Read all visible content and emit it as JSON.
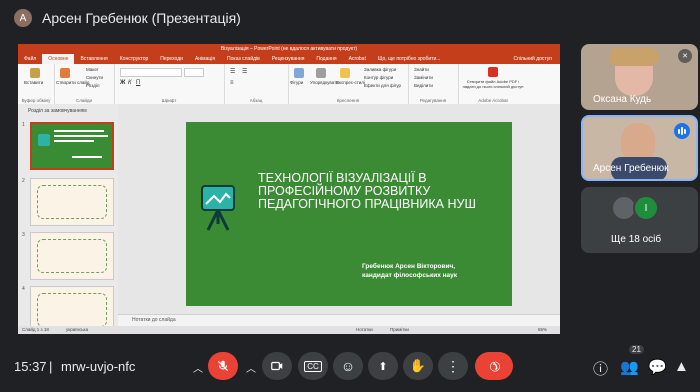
{
  "header": {
    "presenter_initial": "А",
    "title": "Арсен Гребенюк (Презентація)"
  },
  "powerpoint": {
    "window_title": "Візуалізація – PowerPoint (не вдалося активувати продукт)",
    "tabs": [
      "Файл",
      "Основне",
      "Вставлення",
      "Конструктор",
      "Переходи",
      "Анімація",
      "Показ слайдів",
      "Рецензування",
      "Подання",
      "Acrobat"
    ],
    "active_tab": "Основне",
    "search_hint": "Що, ще потрібно зробити...",
    "share_label": "Спільний доступ",
    "ribbon": {
      "groups": [
        "Буфер обміну",
        "Слайди",
        "Шрифт",
        "Абзац",
        "Креслення",
        "Редагування",
        "Adobe Acrobat"
      ],
      "paste": "Вставити",
      "new_slide": "Створити слайд",
      "layout": "Макет",
      "reset": "Скинути",
      "section": "Розділ",
      "shapes": "Фігури",
      "arrange": "Упорядкувати",
      "quick_styles": "Експрес-стилі",
      "shape_fill": "Заливка фігури",
      "shape_outline": "Контур фігури",
      "shape_effects": "Ефекти для фігур",
      "find": "Знайти",
      "replace": "Замінити",
      "select": "Виділити",
      "acrobat_create": "Створити файл Adobe PDF і надати до нього спільний доступ"
    },
    "thumbs_header": "Розділ за замовчуванням",
    "thumb_numbers": [
      "1",
      "2",
      "3",
      "4"
    ],
    "slide": {
      "title": "Технології візуалізації в професійному розвитку педагогічного працівника НУШ",
      "author": "Гребенюк Арсен Вікторович,",
      "author_degree": "кандидат філософських наук"
    },
    "notes_placeholder": "Нотатки до слайда",
    "status": {
      "slide_count": "Слайд 1 з 18",
      "language": "українська",
      "notes": "Нотатки",
      "comments": "Примітки",
      "zoom": "65%"
    }
  },
  "participants": [
    {
      "name": "Оксана Кудь",
      "muted": true
    },
    {
      "name": "Арсен Гребенюк",
      "speaking": true
    },
    {
      "name": "Ще 18 осіб",
      "mini_initial": "І"
    }
  ],
  "bottom_bar": {
    "time": "15:37",
    "separator": "|",
    "meeting_code": "mrw-uvjo-nfc",
    "people_count": "21",
    "colors": {
      "mic_off": "#ea4335",
      "end_call": "#ea4335",
      "dark_button": "#3c4043"
    }
  },
  "icons": [
    "mic-off-icon",
    "camera-icon",
    "captions-icon",
    "emoji-icon",
    "present-icon",
    "raise-hand-icon",
    "more-vert-icon",
    "end-call-icon",
    "info-icon",
    "people-icon",
    "chat-icon",
    "activities-icon"
  ]
}
